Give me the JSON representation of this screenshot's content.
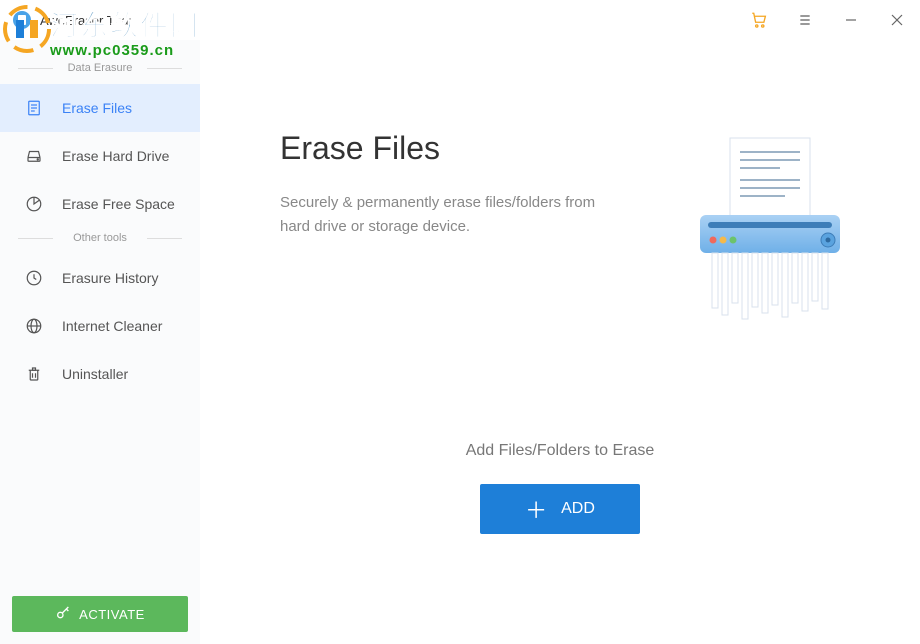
{
  "app": {
    "title": "AweEraser Trial"
  },
  "titlebar": {
    "cart": "cart-icon",
    "menu": "menu-icon",
    "minimize": "—",
    "close": "✕"
  },
  "sidebar": {
    "section1_label": "Data Erasure",
    "section2_label": "Other tools",
    "items": [
      {
        "label": "Erase Files",
        "icon": "file-icon",
        "active": true
      },
      {
        "label": "Erase Hard Drive",
        "icon": "drive-icon",
        "active": false
      },
      {
        "label": "Erase Free Space",
        "icon": "piechart-icon",
        "active": false
      }
    ],
    "tools": [
      {
        "label": "Erasure History",
        "icon": "clock-icon"
      },
      {
        "label": "Internet Cleaner",
        "icon": "globe-icon"
      },
      {
        "label": "Uninstaller",
        "icon": "trash-icon"
      }
    ]
  },
  "activate": {
    "label": "ACTIVATE"
  },
  "content": {
    "title": "Erase Files",
    "description": "Securely & permanently erase files/folders from hard drive or storage device."
  },
  "add": {
    "hint": "Add Files/Folders to Erase",
    "button_label": "ADD"
  },
  "watermark": {
    "cn": "河东软件园",
    "url": "www.pc0359.cn"
  }
}
